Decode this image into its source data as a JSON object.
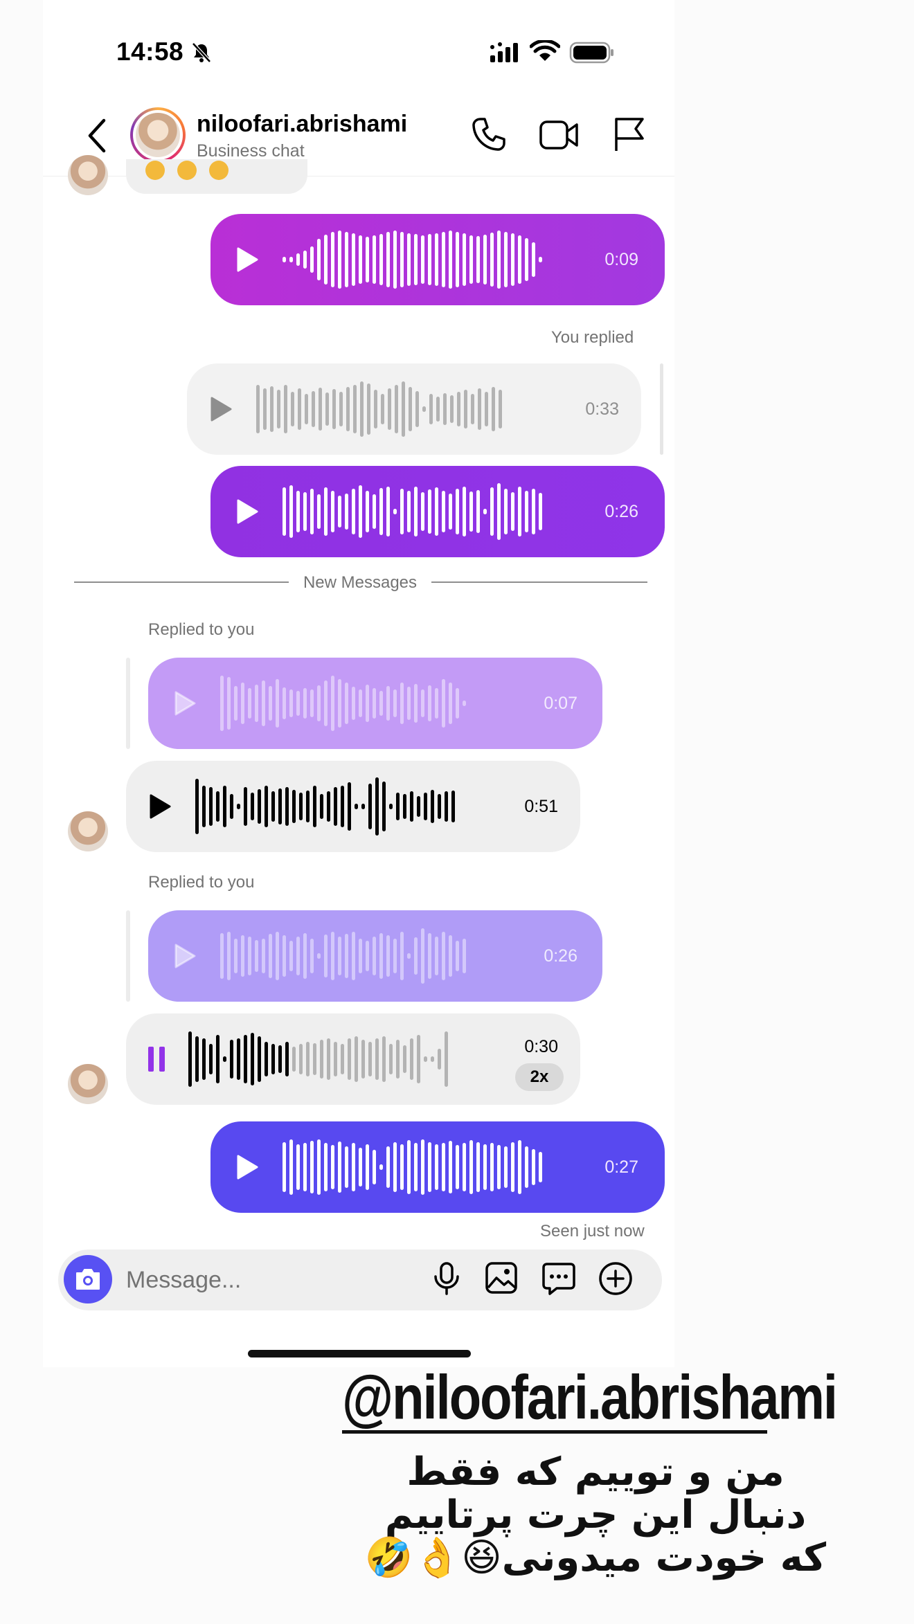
{
  "status_bar": {
    "time": "14:58"
  },
  "header": {
    "username": "niloofari.abrishami",
    "subtitle": "Business chat"
  },
  "messages": {
    "out1_duration": "0:09",
    "reply_label_out": "You replied",
    "reply_quote_out_duration": "0:33",
    "out2_duration": "0:26",
    "new_messages": "New Messages",
    "replied_label_1": "Replied to you",
    "quote1_duration": "0:07",
    "in1_duration": "0:51",
    "replied_label_2": "Replied to you",
    "quote2_duration": "0:26",
    "in2_duration": "0:30",
    "in2_speed": "2x",
    "in2_progress": 0.37,
    "out3_duration": "0:27",
    "seen": "Seen just now"
  },
  "composer": {
    "placeholder": "Message..."
  },
  "overlay": {
    "handle": "@niloofari.abrishami",
    "caption": "من و توییم که فقط دنبال این چرت پرتاییم که خودت میدونی😆👌🤣"
  },
  "colors": {
    "outgoing_1": "#b92fd6",
    "outgoing_2": "#9131e2",
    "outgoing_3": "#5849f0",
    "quote_1": "#c39bf6",
    "quote_2": "#b09cf7",
    "incoming": "#efefef",
    "camera_button": "#5851f3",
    "pause_accent": "#9233e8"
  },
  "icons": [
    "back-icon",
    "bell-slash-icon",
    "signal-icon",
    "wifi-icon",
    "battery-icon",
    "call-icon",
    "video-icon",
    "flag-icon",
    "play-icon",
    "pause-icon",
    "camera-icon",
    "mic-icon",
    "image-icon",
    "sticker-icon",
    "plus-icon"
  ]
}
